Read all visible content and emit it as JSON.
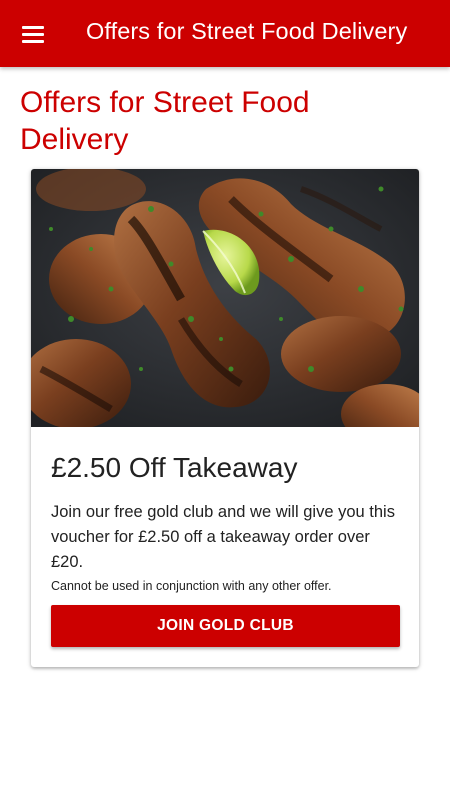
{
  "appbar": {
    "title": "Offers for Street Food Delivery",
    "menu_icon": "hamburger-menu-icon",
    "color": "#cc0000"
  },
  "page": {
    "heading": "Offers for Street Food Delivery"
  },
  "offer": {
    "image": "grilled-chicken-drumsticks-with-lime",
    "title": "£2.50 Off Takeaway",
    "description": "Join our free gold club and we will give you this voucher for £2.50 off a takeaway order over £20.",
    "note": "Cannot be used in conjunction with any other offer.",
    "button_label": "JOIN GOLD CLUB"
  },
  "colors": {
    "accent": "#cc0000",
    "text": "#222222",
    "background": "#ffffff"
  }
}
